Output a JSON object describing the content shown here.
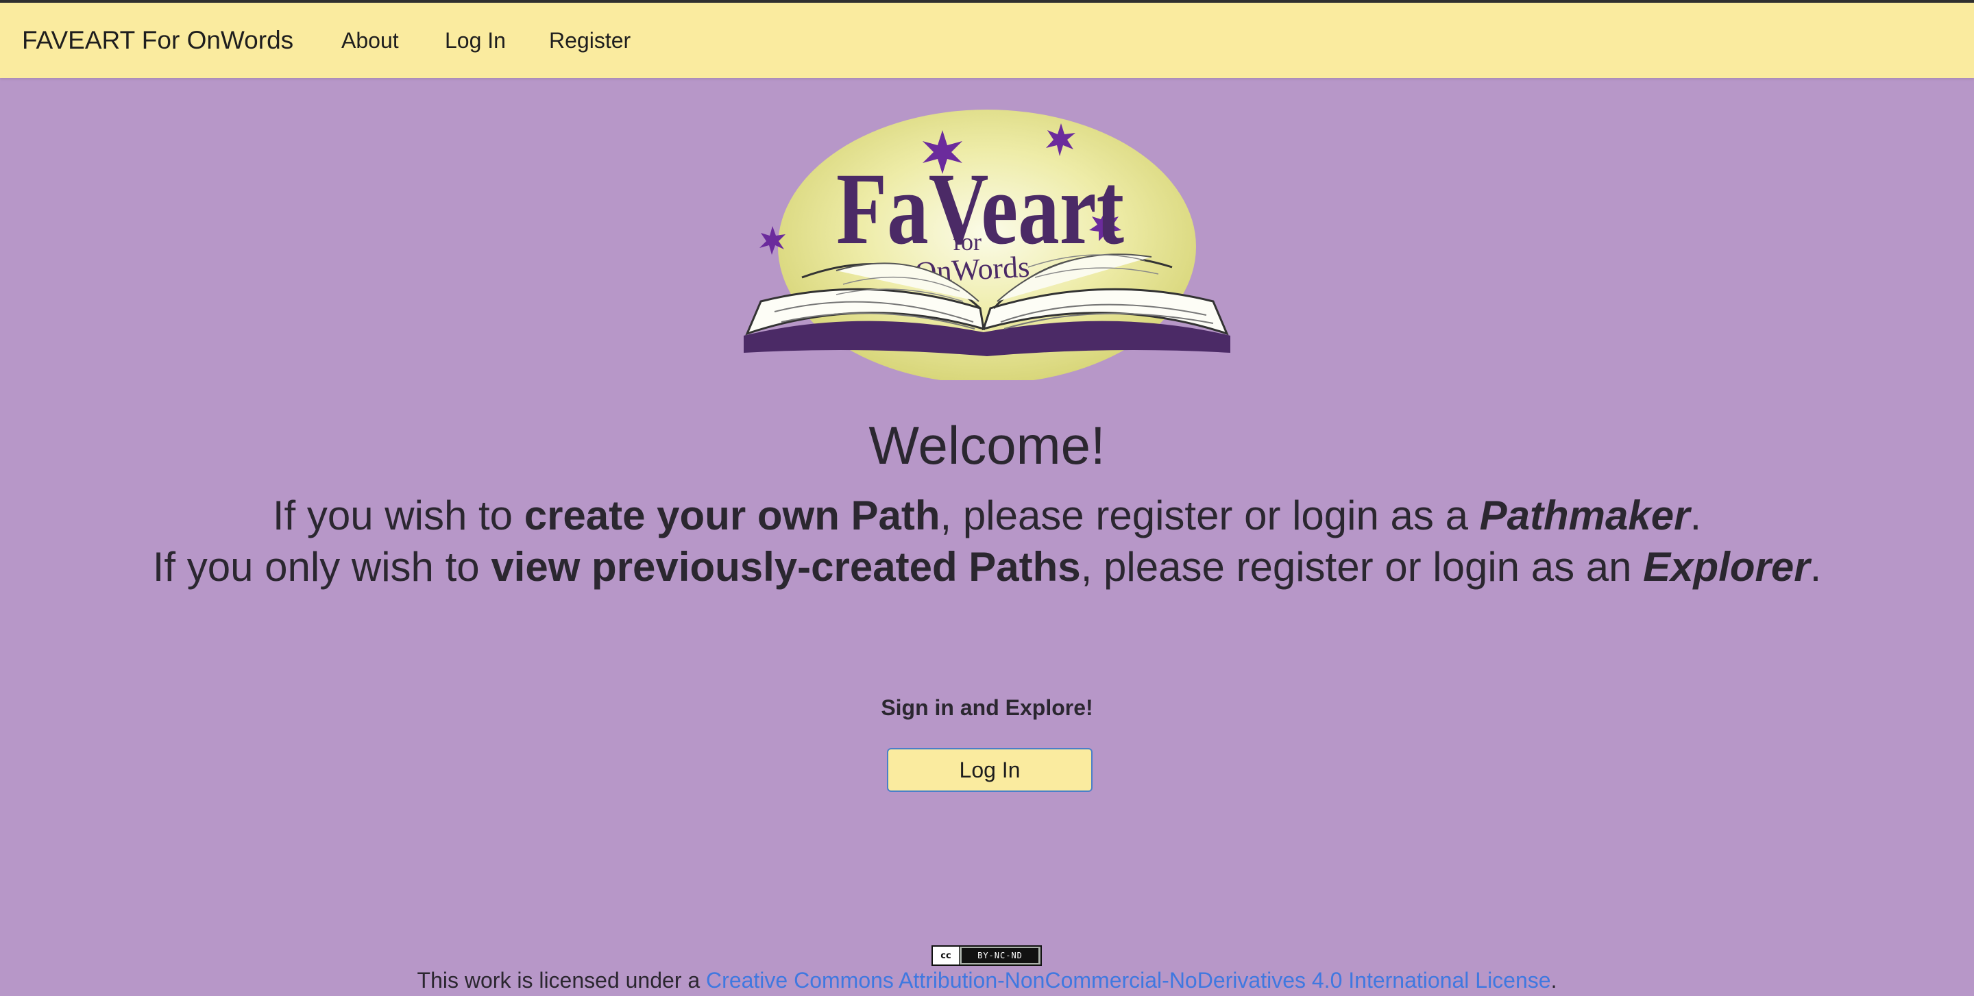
{
  "nav": {
    "brand": "FAVEART For OnWords",
    "about": "About",
    "login": "Log In",
    "register": "Register"
  },
  "logo": {
    "title_main": "FaVeart",
    "title_for": "for",
    "title_sub": "OnWords"
  },
  "main": {
    "welcome": "Welcome!",
    "line1": {
      "pre": "If you wish to ",
      "bold": "create your own Path",
      "mid": ", please register or login as a ",
      "role": "Pathmaker",
      "end": "."
    },
    "line2": {
      "pre": "If you only wish to ",
      "bold": "view previously-created Paths",
      "mid": ", please register or login as an ",
      "role": "Explorer",
      "end": "."
    },
    "signin_label": "Sign in and Explore!",
    "login_button": "Log In"
  },
  "footer": {
    "badge_cc": "cc",
    "badge_text": "BY-NC-ND",
    "license_prefix": "This work is licensed under a ",
    "license_link": "Creative Commons Attribution-NonCommercial-NoDerivatives 4.0 International License",
    "license_suffix": "."
  },
  "colors": {
    "background": "#b797c8",
    "navbar": "#faeb9f",
    "link": "#3f78e0",
    "logo_purple": "#4b2a66"
  }
}
